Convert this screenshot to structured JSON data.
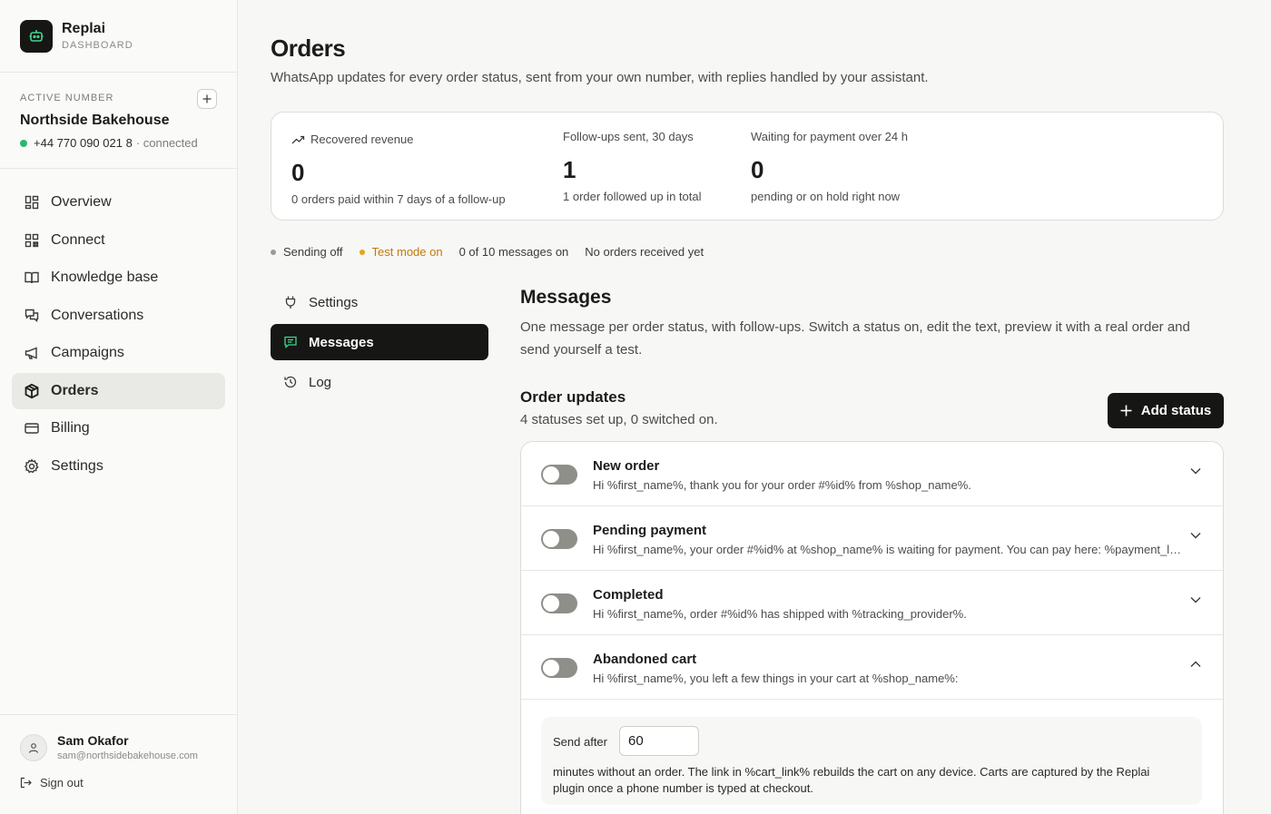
{
  "brand": {
    "name": "Replai",
    "sub": "DASHBOARD"
  },
  "active_number": {
    "label": "ACTIVE NUMBER",
    "business": "Northside Bakehouse",
    "phone": "+44 770 090 021 8",
    "status": "· connected"
  },
  "nav": [
    {
      "label": "Overview",
      "icon": "grid-icon"
    },
    {
      "label": "Connect",
      "icon": "qr-icon"
    },
    {
      "label": "Knowledge base",
      "icon": "book-icon"
    },
    {
      "label": "Conversations",
      "icon": "chat-icon"
    },
    {
      "label": "Campaigns",
      "icon": "megaphone-icon"
    },
    {
      "label": "Orders",
      "icon": "package-icon",
      "active": true
    },
    {
      "label": "Billing",
      "icon": "card-icon"
    },
    {
      "label": "Settings",
      "icon": "gear-icon"
    }
  ],
  "user": {
    "name": "Sam Okafor",
    "email": "sam@northsidebakehouse.com",
    "signout": "Sign out"
  },
  "page": {
    "title": "Orders",
    "subtitle": "WhatsApp updates for every order status, sent from your own number, with replies handled by your assistant."
  },
  "stats": [
    {
      "label": "Recovered revenue",
      "value": "0",
      "note": "0 orders paid within 7 days of a follow-up"
    },
    {
      "label": "Follow-ups sent, 30 days",
      "value": "1",
      "note": "1 order followed up in total"
    },
    {
      "label": "Waiting for payment over 24 h",
      "value": "0",
      "note": "pending or on hold right now"
    }
  ],
  "statusbar": {
    "sending": "Sending off",
    "test_mode": "Test mode on",
    "messages_on": "0 of 10 messages on",
    "orders": "No orders received yet",
    "colors": {
      "sending_dot": "#9a9a96",
      "test_dot": "#e8a21b"
    }
  },
  "subnav": [
    {
      "label": "Settings",
      "icon": "plug-icon"
    },
    {
      "label": "Messages",
      "icon": "message-icon",
      "active": true
    },
    {
      "label": "Log",
      "icon": "history-icon"
    }
  ],
  "messages": {
    "title": "Messages",
    "description": "One message per order status, with follow-ups. Switch a status on, edit the text, preview it with a real order and send yourself a test.",
    "order_updates_title": "Order updates",
    "order_updates_sub": "4 statuses set up, 0 switched on.",
    "add_button": "Add status"
  },
  "statuses": [
    {
      "title": "New order",
      "message": "Hi %first_name%, thank you for your order #%id% from %shop_name%.",
      "enabled": false,
      "expanded": false
    },
    {
      "title": "Pending payment",
      "message": "Hi %first_name%, your order #%id% at %shop_name% is waiting for payment. You can pay here: %payment_link%",
      "enabled": false,
      "expanded": false
    },
    {
      "title": "Completed",
      "message": "Hi %first_name%, order #%id% has shipped with %tracking_provider%.",
      "enabled": false,
      "expanded": false
    },
    {
      "title": "Abandoned cart",
      "message": "Hi %first_name%, you left a few things in your cart at %shop_name%:",
      "enabled": false,
      "expanded": true
    }
  ],
  "abandoned": {
    "send_after_label": "Send after",
    "send_after_value": "60",
    "note": "minutes without an order. The link in %cart_link% rebuilds the cart on any device. Carts are captured by the Replai plugin once a phone number is typed at checkout."
  }
}
